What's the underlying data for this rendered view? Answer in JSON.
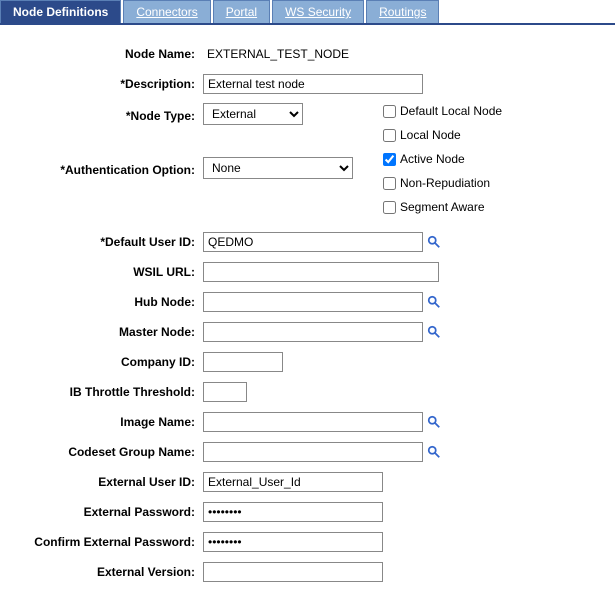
{
  "tabs": {
    "node_definitions": "Node Definitions",
    "connectors": "Connectors",
    "portal": "Portal",
    "ws_security": "WS Security",
    "routings": "Routings"
  },
  "labels": {
    "node_name": "Node Name:",
    "description": "*Description:",
    "node_type": "*Node Type:",
    "auth_option": "*Authentication Option:",
    "default_user_id": "*Default User ID:",
    "wsil_url": "WSIL URL:",
    "hub_node": "Hub Node:",
    "master_node": "Master Node:",
    "company_id": "Company ID:",
    "ib_throttle": "IB Throttle Threshold:",
    "image_name": "Image Name:",
    "codeset_group": "Codeset Group Name:",
    "external_user_id": "External User ID:",
    "external_password": "External Password:",
    "confirm_external_password": "Confirm External Password:",
    "external_version": "External Version:"
  },
  "values": {
    "node_name": "EXTERNAL_TEST_NODE",
    "description": "External test node",
    "node_type": "External",
    "auth_option": "None",
    "default_user_id": "QEDMO",
    "wsil_url": "",
    "hub_node": "",
    "master_node": "",
    "company_id": "",
    "ib_throttle": "",
    "image_name": "",
    "codeset_group": "",
    "external_user_id": "External_User_Id",
    "external_password": "••••••••",
    "confirm_external_password": "••••••••",
    "external_version": ""
  },
  "checkboxes": {
    "default_local_node": {
      "label": "Default Local Node",
      "checked": false
    },
    "local_node": {
      "label": "Local Node",
      "checked": false
    },
    "active_node": {
      "label": "Active Node",
      "checked": true
    },
    "non_repudiation": {
      "label": "Non-Repudiation",
      "checked": false
    },
    "segment_aware": {
      "label": "Segment Aware",
      "checked": false
    }
  }
}
